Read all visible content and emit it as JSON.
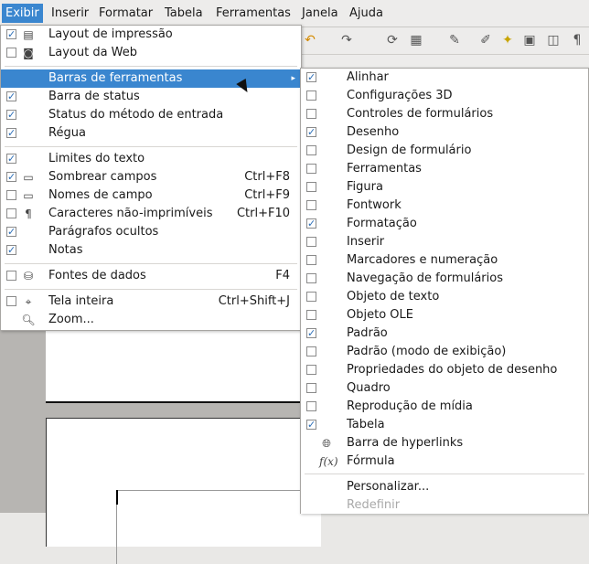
{
  "menubar": {
    "items": [
      "Exibir",
      "Inserir",
      "Formatar",
      "Tabela",
      "Ferramentas",
      "Janela",
      "Ajuda"
    ]
  },
  "view_menu": {
    "items": [
      {
        "label": "Layout de impressão",
        "checked": true,
        "icon": "print-layout-icon"
      },
      {
        "label": "Layout da Web",
        "checked": false,
        "icon": "web-layout-icon"
      },
      {
        "label": "Barras de ferramentas",
        "submenu": true
      },
      {
        "label": "Barra de status",
        "checked": true
      },
      {
        "label": "Status do método de entrada",
        "checked": true
      },
      {
        "label": "Régua",
        "checked": true
      },
      {
        "label": "Limites do texto",
        "checked": true
      },
      {
        "label": "Sombrear campos",
        "checked": true,
        "icon": "field-shading-icon",
        "shortcut": "Ctrl+F8"
      },
      {
        "label": "Nomes de campo",
        "checked": false,
        "icon": "field-names-icon",
        "shortcut": "Ctrl+F9"
      },
      {
        "label": "Caracteres não-imprimíveis",
        "checked": false,
        "icon": "pilcrow-icon",
        "shortcut": "Ctrl+F10"
      },
      {
        "label": "Parágrafos ocultos",
        "checked": true
      },
      {
        "label": "Notas",
        "checked": true
      },
      {
        "label": "Fontes de dados",
        "checked": false,
        "icon": "database-icon",
        "shortcut": "F4"
      },
      {
        "label": "Tela inteira",
        "checked": false,
        "icon": "full-screen-icon",
        "shortcut": "Ctrl+Shift+J"
      },
      {
        "label": "Zoom...",
        "icon": "zoom-icon"
      }
    ]
  },
  "toolbars_menu": {
    "items": [
      {
        "label": "Alinhar",
        "checked": true
      },
      {
        "label": "Configurações 3D",
        "checked": false
      },
      {
        "label": "Controles de formulários",
        "checked": false
      },
      {
        "label": "Desenho",
        "checked": true
      },
      {
        "label": "Design de formulário",
        "checked": false
      },
      {
        "label": "Ferramentas",
        "checked": false
      },
      {
        "label": "Figura",
        "checked": false
      },
      {
        "label": "Fontwork",
        "checked": false
      },
      {
        "label": "Formatação",
        "checked": true
      },
      {
        "label": "Inserir",
        "checked": false
      },
      {
        "label": "Marcadores e numeração",
        "checked": false
      },
      {
        "label": "Navegação de formulários",
        "checked": false
      },
      {
        "label": "Objeto de texto",
        "checked": false
      },
      {
        "label": "Objeto OLE",
        "checked": false
      },
      {
        "label": "Padrão",
        "checked": true
      },
      {
        "label": "Padrão (modo de exibição)",
        "checked": false
      },
      {
        "label": "Propriedades do objeto de desenho",
        "checked": false
      },
      {
        "label": "Quadro",
        "checked": false
      },
      {
        "label": "Reprodução de mídia",
        "checked": false
      },
      {
        "label": "Tabela",
        "checked": true
      },
      {
        "label": "Barra de hyperlinks",
        "icon": "hyperlink-bar-icon"
      },
      {
        "label": "Fórmula",
        "icon": "formula-icon"
      },
      {
        "label": "Personalizar..."
      },
      {
        "label": "Redefinir",
        "disabled": true
      }
    ]
  },
  "colors": {
    "highlight": "#3a86cf",
    "check": "#2a6db7"
  }
}
